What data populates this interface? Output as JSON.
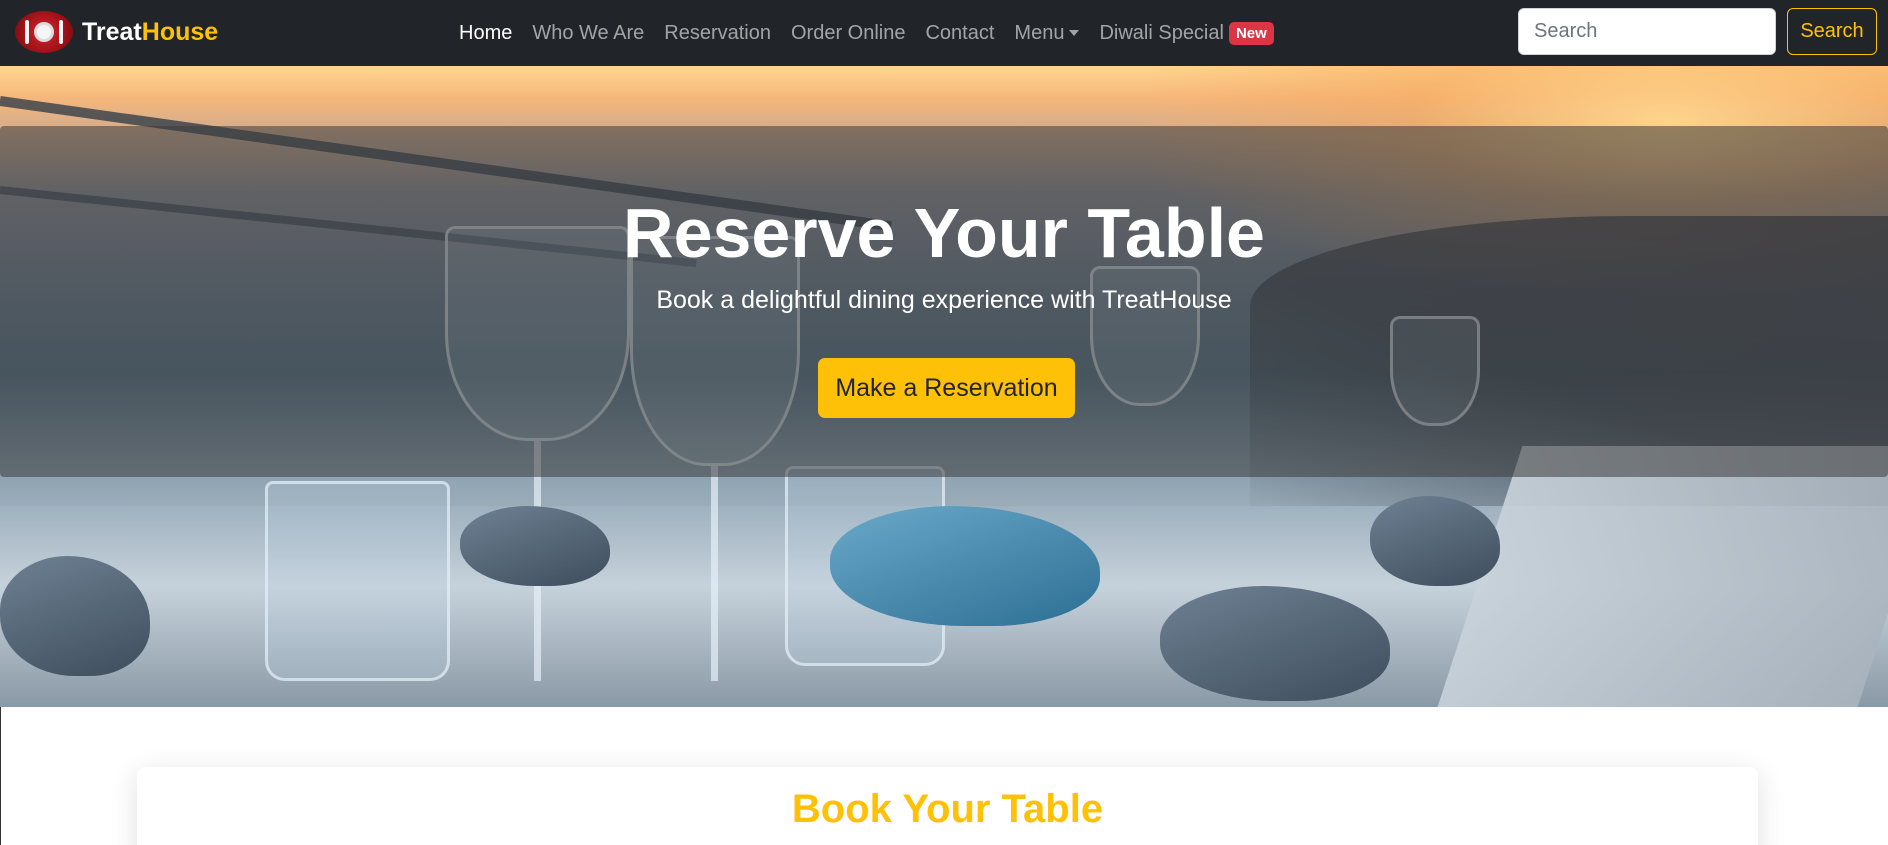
{
  "brand": {
    "part1": "Treat",
    "part2": "House",
    "logo_icon": "plate-fork-knife-icon"
  },
  "nav": {
    "items": [
      {
        "label": "Home",
        "active": true
      },
      {
        "label": "Who We Are"
      },
      {
        "label": "Reservation"
      },
      {
        "label": "Order Online"
      },
      {
        "label": "Contact"
      },
      {
        "label": "Menu",
        "dropdown": true
      },
      {
        "label": "Diwali Special",
        "badge": "New"
      }
    ]
  },
  "search": {
    "placeholder": "Search",
    "button_label": "Search"
  },
  "hero": {
    "title": "Reserve Your Table",
    "subtitle": "Book a delightful dining experience with TreatHouse",
    "cta_label": "Make a Reservation"
  },
  "booking": {
    "title": "Book Your Table"
  },
  "colors": {
    "navbar": "#212529",
    "accent": "#ffc107",
    "badge": "#dc3545"
  }
}
